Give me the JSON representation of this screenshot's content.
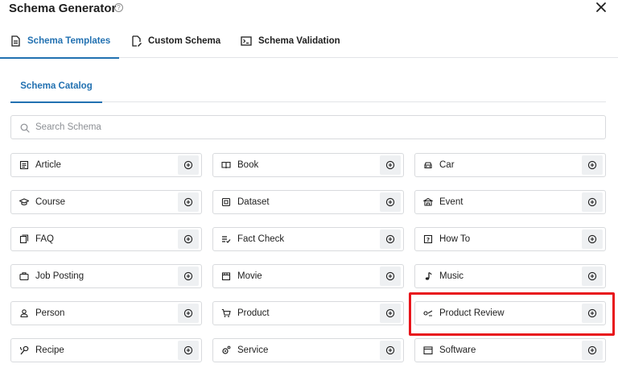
{
  "dialog": {
    "title": "Schema Generator",
    "help_icon": "help-circle-icon",
    "close_icon": "close-icon"
  },
  "tabs": [
    {
      "label": "Schema Templates",
      "icon": "document-icon",
      "active": true
    },
    {
      "label": "Custom Schema",
      "icon": "edit-document-icon",
      "active": false
    },
    {
      "label": "Schema Validation",
      "icon": "terminal-icon",
      "active": false
    }
  ],
  "subtabs": [
    {
      "label": "Schema Catalog",
      "active": true
    }
  ],
  "search": {
    "placeholder": "Search Schema",
    "value": ""
  },
  "schemas": [
    {
      "label": "Article",
      "icon": "article-icon"
    },
    {
      "label": "Book",
      "icon": "book-icon"
    },
    {
      "label": "Car",
      "icon": "car-icon"
    },
    {
      "label": "Course",
      "icon": "graduation-cap-icon"
    },
    {
      "label": "Dataset",
      "icon": "dataset-icon"
    },
    {
      "label": "Event",
      "icon": "event-icon"
    },
    {
      "label": "FAQ",
      "icon": "faq-icon"
    },
    {
      "label": "Fact Check",
      "icon": "fact-check-icon"
    },
    {
      "label": "How To",
      "icon": "how-to-icon"
    },
    {
      "label": "Job Posting",
      "icon": "briefcase-icon"
    },
    {
      "label": "Movie",
      "icon": "movie-icon"
    },
    {
      "label": "Music",
      "icon": "music-note-icon"
    },
    {
      "label": "Person",
      "icon": "person-icon"
    },
    {
      "label": "Product",
      "icon": "cart-icon"
    },
    {
      "label": "Product Review",
      "icon": "review-icon",
      "highlighted": true
    },
    {
      "label": "Recipe",
      "icon": "recipe-icon"
    },
    {
      "label": "Service",
      "icon": "service-icon"
    },
    {
      "label": "Software",
      "icon": "software-icon"
    }
  ],
  "colors": {
    "accent": "#2271b1",
    "highlight": "#e8151b",
    "border": "#d8dadd",
    "add_button_bg": "#eef0f2"
  }
}
